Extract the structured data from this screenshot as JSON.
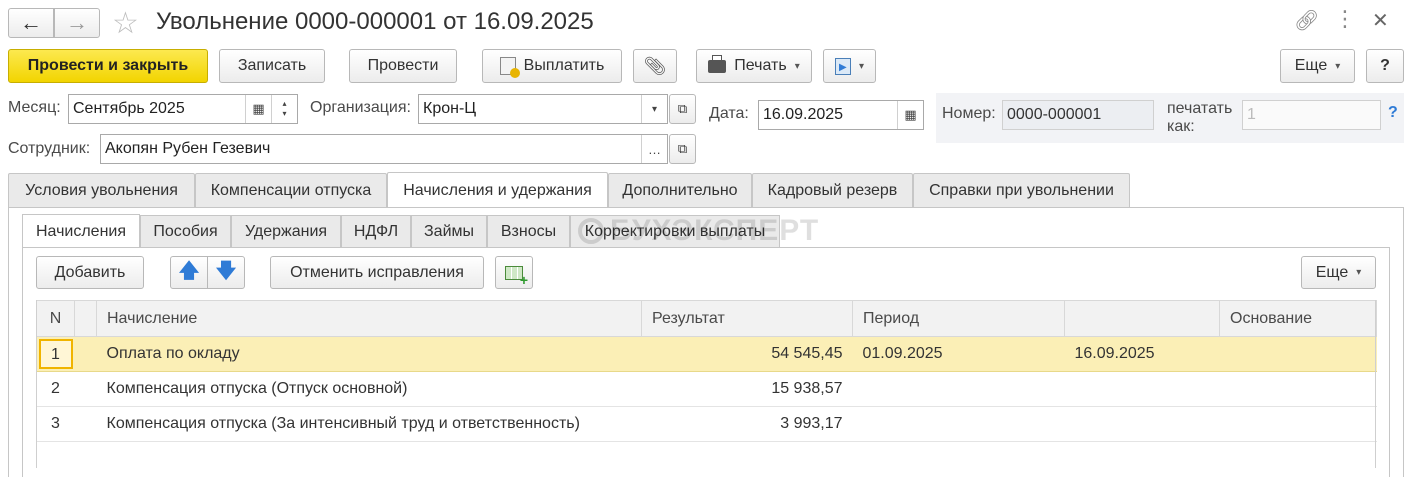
{
  "header": {
    "title": "Увольнение 0000-000001 от 16.09.2025",
    "back_icon": "arrow-left-icon",
    "forward_icon": "arrow-right-icon",
    "favorite_icon": "star-icon"
  },
  "toolbar": {
    "post_close": "Провести и закрыть",
    "save": "Записать",
    "post": "Провести",
    "pay": "Выплатить",
    "print": "Печать",
    "more": "Еще",
    "help": "?"
  },
  "form": {
    "month_label": "Месяц:",
    "month_value": "Сентябрь 2025",
    "org_label": "Организация:",
    "org_value": "Крон-Ц",
    "date_label": "Дата:",
    "date_value": "16.09.2025",
    "number_label": "Номер:",
    "number_value": "0000-000001",
    "print_as_label": "печатать как:",
    "print_as_placeholder": "1",
    "employee_label": "Сотрудник:",
    "employee_value": "Акопян Рубен Гезевич",
    "help_mark": "?"
  },
  "tabs": [
    "Условия увольнения",
    "Компенсации отпуска",
    "Начисления и удержания",
    "Дополнительно",
    "Кадровый резерв",
    "Справки при увольнении"
  ],
  "subtabs": [
    "Начисления",
    "Пособия",
    "Удержания",
    "НДФЛ",
    "Займы",
    "Взносы",
    "Корректировки выплаты"
  ],
  "watermark": "БУХЭКСПЕРТ",
  "table_toolbar": {
    "add": "Добавить",
    "cancel_fix": "Отменить исправления",
    "more": "Еще"
  },
  "table": {
    "columns": [
      "N",
      "Начисление",
      "Результат",
      "Период",
      "",
      "Основание"
    ],
    "rows": [
      [
        "1",
        "Оплата по окладу",
        "54 545,45",
        "01.09.2025",
        "16.09.2025",
        ""
      ],
      [
        "2",
        "Компенсация отпуска (Отпуск основной)",
        "15 938,57",
        "",
        "",
        ""
      ],
      [
        "3",
        "Компенсация отпуска (За интенсивный труд и ответственность)",
        "3 993,17",
        "",
        "",
        ""
      ]
    ]
  },
  "colors": {
    "primary_button": "#f2d400",
    "selected_row": "#fbefb6",
    "arrow_blue": "#2f7bd6"
  }
}
